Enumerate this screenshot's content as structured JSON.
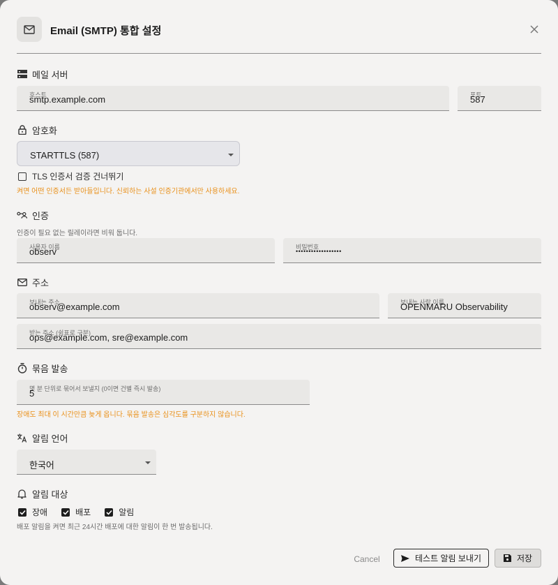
{
  "dialog": {
    "title": "Email (SMTP) 통합 설정",
    "icon": "mail-icon",
    "close_icon": "close-icon"
  },
  "server": {
    "heading": "메일 서버",
    "host": {
      "label": "호스트",
      "value": "smtp.example.com"
    },
    "port": {
      "label": "포트",
      "value": "587"
    }
  },
  "encryption": {
    "heading": "암호화",
    "selected": "STARTTLS (587)",
    "skip_tls_label": "TLS 인증서 검증 건너뛰기",
    "skip_tls_checked": false,
    "warning": "켜면 어떤 인증서든 받아들입니다. 신뢰하는 사설 인증기관에서만 사용하세요."
  },
  "auth": {
    "heading": "인증",
    "hint": "인증이 필요 없는 릴레이라면 비워 둡니다.",
    "username": {
      "label": "사용자 이름",
      "value": "observ"
    },
    "password": {
      "label": "비밀번호",
      "value": "••••••••••••••••••"
    }
  },
  "address": {
    "heading": "주소",
    "from": {
      "label": "보내는 주소",
      "value": "observ@example.com"
    },
    "from_name": {
      "label": "보내는 사람 이름",
      "value": "OPENMARU Observability"
    },
    "to": {
      "label": "받는 주소 (쉼표로 구분)",
      "value": "ops@example.com, sre@example.com"
    }
  },
  "batch": {
    "heading": "묶음 발송",
    "minutes": {
      "label": "몇 분 단위로 묶어서 보낼지 (0이면 건별 즉시 발송)",
      "value": "5"
    },
    "warning": "장애도 최대 이 시간만큼 늦게 옵니다. 묶음 발송은 심각도를 구분하지 않습니다."
  },
  "language": {
    "heading": "알림 언어",
    "selected": "한국어"
  },
  "targets": {
    "heading": "알림 대상",
    "items": [
      {
        "label": "장애",
        "checked": true
      },
      {
        "label": "배포",
        "checked": true
      },
      {
        "label": "알림",
        "checked": true
      }
    ],
    "hint": "배포 알림을 켜면 최근 24시간 배포에 대한 알림이 한 번 발송됩니다."
  },
  "footer": {
    "cancel": "Cancel",
    "test": "테스트 알림 보내기",
    "save": "저장"
  },
  "colors": {
    "accent_warning": "#e9901a",
    "select_highlight": "#e6e6ea",
    "background": "#f4f3f2"
  }
}
